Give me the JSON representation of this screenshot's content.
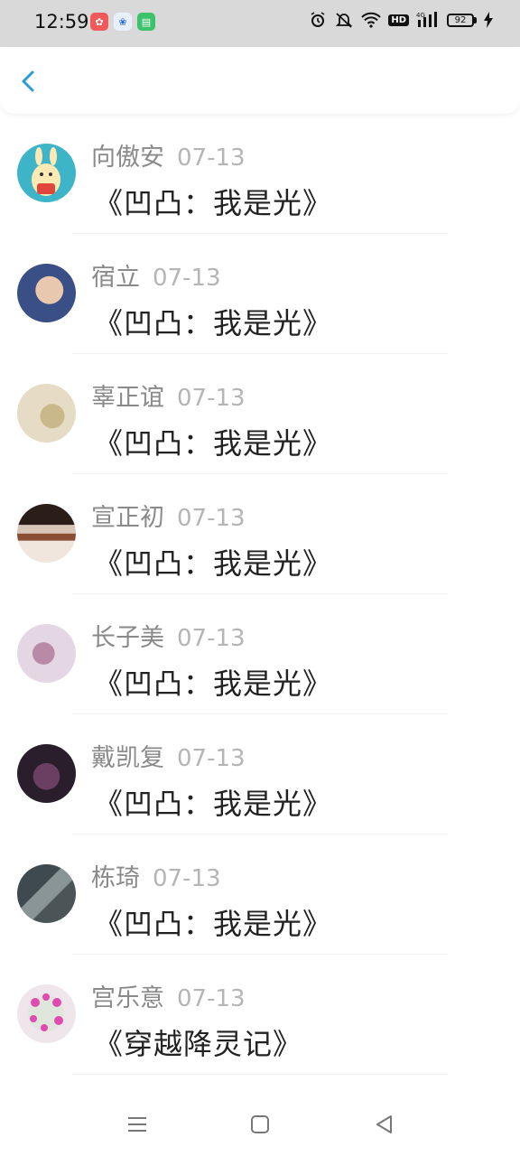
{
  "status_bar": {
    "time": "12:59",
    "battery": "92",
    "network": "4G",
    "hd": "HD"
  },
  "header": {
    "back_icon": "chevron-left-icon",
    "accent": "#2a9bd8"
  },
  "items": [
    {
      "name": "向傲安",
      "date": "07-13",
      "title": "《凹凸：我是光》",
      "avatar_color": "#3db4c8"
    },
    {
      "name": "宿立",
      "date": "07-13",
      "title": "《凹凸：我是光》",
      "avatar_color": "#4d6fa8"
    },
    {
      "name": "辜正谊",
      "date": "07-13",
      "title": "《凹凸：我是光》",
      "avatar_color": "#d8c9a6"
    },
    {
      "name": "宣正初",
      "date": "07-13",
      "title": "《凹凸：我是光》",
      "avatar_color": "#6b4a3a"
    },
    {
      "name": "长子美",
      "date": "07-13",
      "title": "《凹凸：我是光》",
      "avatar_color": "#d9c2d4"
    },
    {
      "name": "戴凯复",
      "date": "07-13",
      "title": "《凹凸：我是光》",
      "avatar_color": "#4a3348"
    },
    {
      "name": "栋琦",
      "date": "07-13",
      "title": "《凹凸：我是光》",
      "avatar_color": "#5c6a6e"
    },
    {
      "name": "宫乐意",
      "date": "07-13",
      "title": "《穿越降灵记》",
      "avatar_color": "#e9dfe6"
    }
  ],
  "nav": {
    "menu_icon": "menu-icon",
    "home_icon": "home-square-icon",
    "back_icon": "back-triangle-icon"
  }
}
